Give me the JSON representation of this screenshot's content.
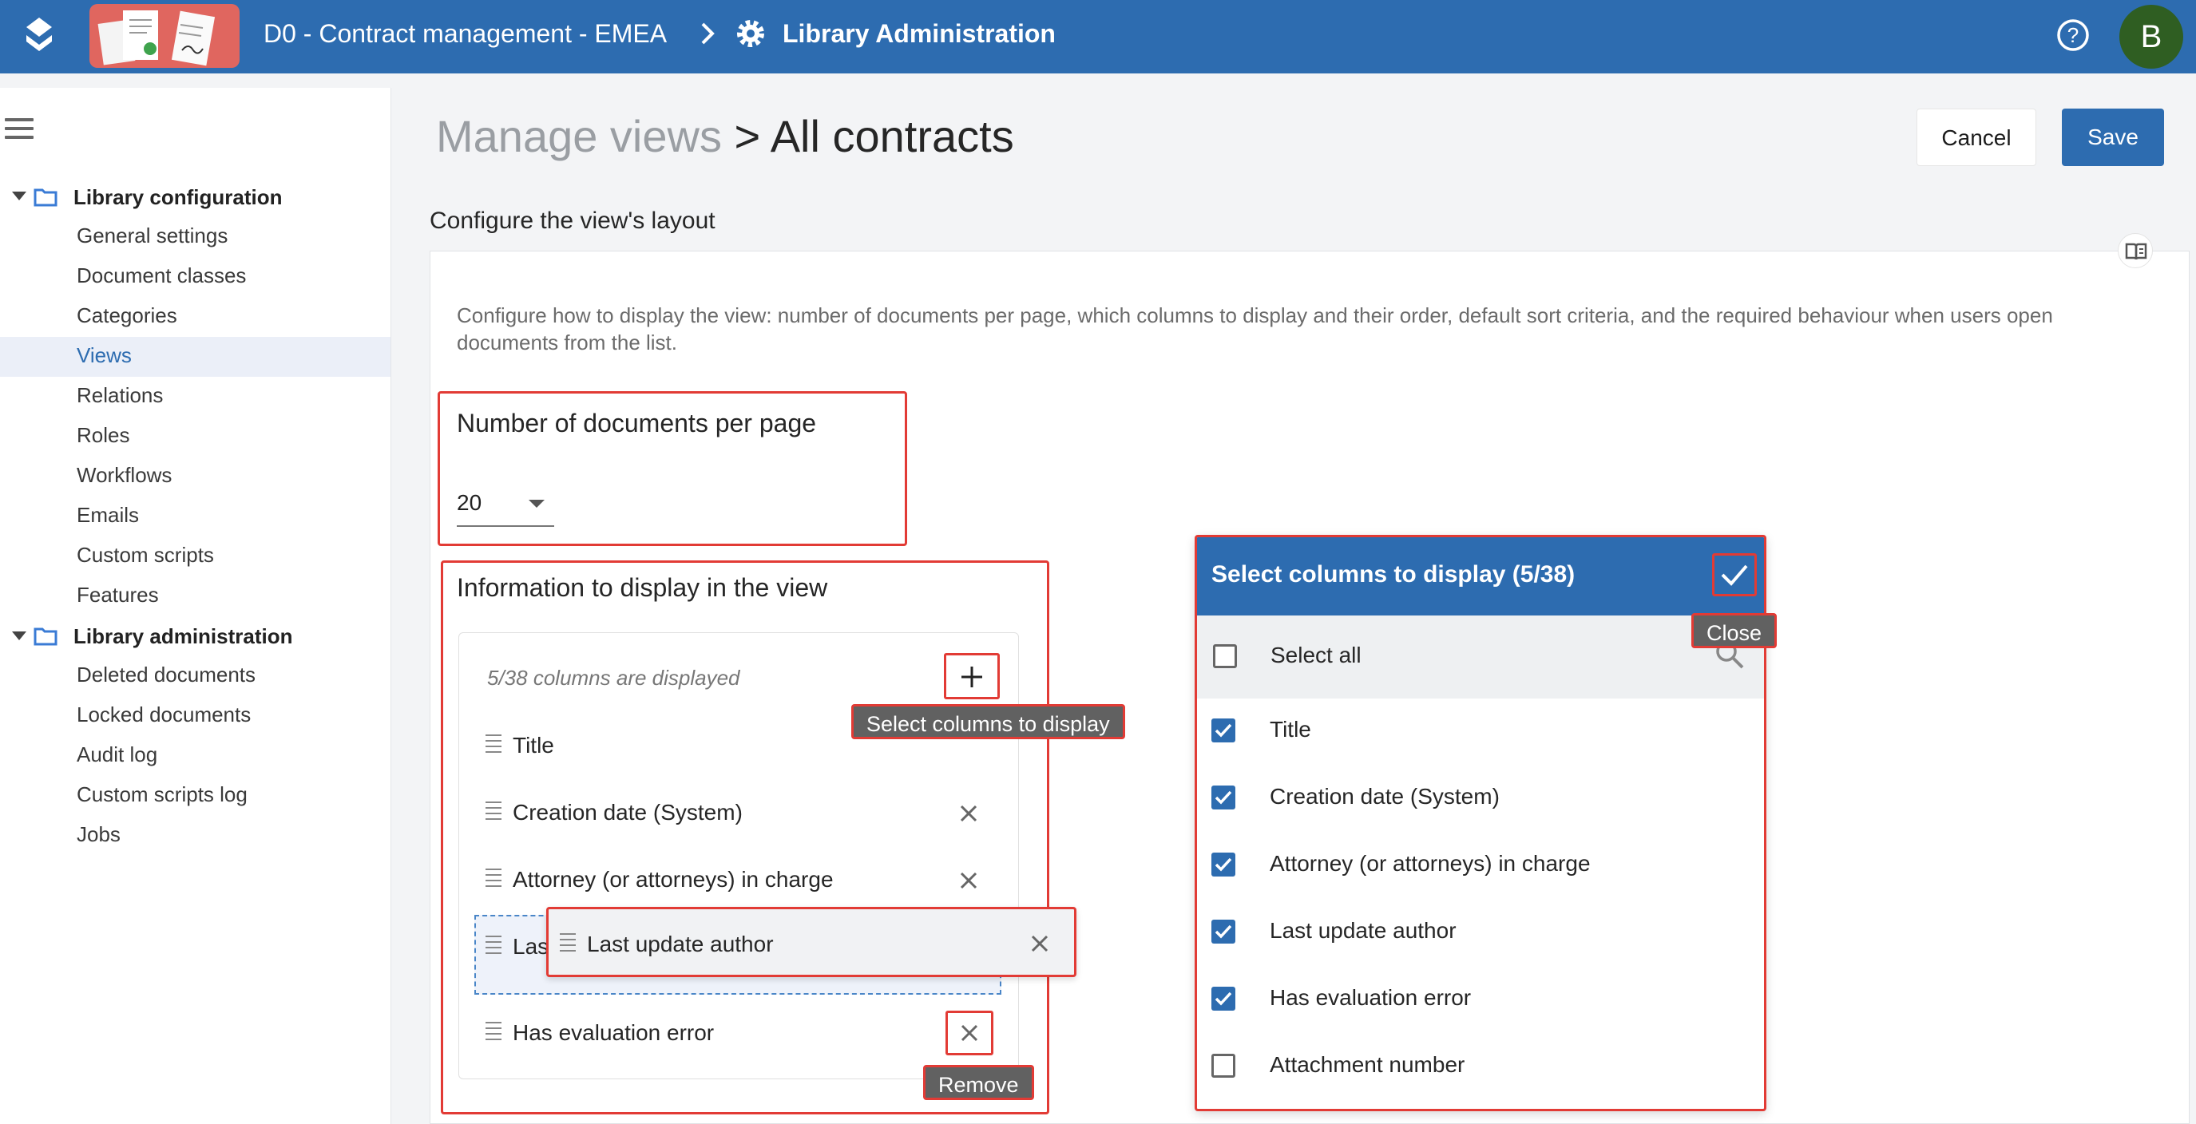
{
  "header": {
    "library_name": "D0 - Contract management - EMEA",
    "section_title": "Library Administration",
    "avatar_initial": "B",
    "bar_color": "#2d6cb0"
  },
  "sidebar": {
    "groups": [
      {
        "title": "Library configuration",
        "items": [
          {
            "label": "General settings"
          },
          {
            "label": "Document classes"
          },
          {
            "label": "Categories"
          },
          {
            "label": "Views",
            "active": true
          },
          {
            "label": "Relations"
          },
          {
            "label": "Roles"
          },
          {
            "label": "Workflows"
          },
          {
            "label": "Emails"
          },
          {
            "label": "Custom scripts"
          },
          {
            "label": "Features"
          }
        ]
      },
      {
        "title": "Library administration",
        "items": [
          {
            "label": "Deleted documents"
          },
          {
            "label": "Locked documents"
          },
          {
            "label": "Audit log"
          },
          {
            "label": "Custom scripts log"
          },
          {
            "label": "Jobs"
          }
        ]
      }
    ]
  },
  "page": {
    "breadcrumb_parent": "Manage views",
    "breadcrumb_current": "> All contracts",
    "cancel_label": "Cancel",
    "save_label": "Save",
    "subtitle": "Configure the view's layout",
    "description": "Configure how to display the view: number of documents per page, which columns to display and their order, default sort criteria, and the required behaviour when users open documents from the list."
  },
  "per_page": {
    "title": "Number of documents per page",
    "value": "20"
  },
  "columns_panel": {
    "title": "Information to display in the view",
    "count_text": "5/38 columns are displayed",
    "rows": [
      {
        "label": "Title"
      },
      {
        "label": "Creation date (System)"
      },
      {
        "label": "Attorney (or attorneys) in charge"
      },
      {
        "label": "Las"
      },
      {
        "label": "Has evaluation error"
      }
    ],
    "dragging_label": "Last update author",
    "tooltip_add": "Select columns to display",
    "tooltip_remove": "Remove"
  },
  "dialog": {
    "title": "Select columns to display (5/38)",
    "close_tooltip": "Close",
    "select_all_label": "Select all",
    "select_all_checked": false,
    "options": [
      {
        "label": "Title",
        "checked": true
      },
      {
        "label": "Creation date (System)",
        "checked": true
      },
      {
        "label": "Attorney (or attorneys) in charge",
        "checked": true
      },
      {
        "label": "Last update author",
        "checked": true
      },
      {
        "label": "Has evaluation error",
        "checked": true
      },
      {
        "label": "Attachment number",
        "checked": false
      }
    ]
  }
}
